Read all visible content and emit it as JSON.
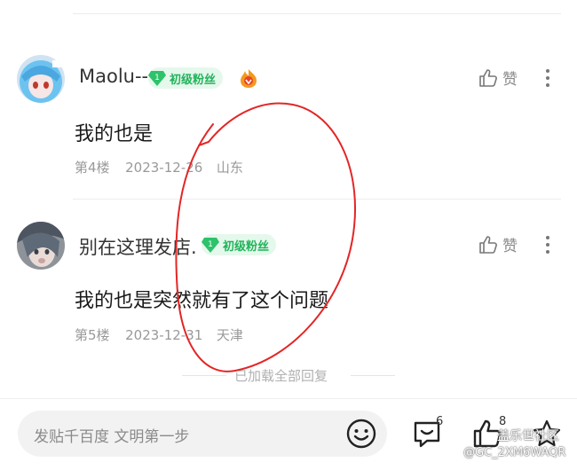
{
  "comments": [
    {
      "username": "Maolu--",
      "level": "1",
      "fan_badge": "初级粉丝",
      "like_label": "赞",
      "content": "我的也是",
      "floor": "第4楼",
      "date": "2023-12-26",
      "location": "山东"
    },
    {
      "username": "别在这理发店.",
      "level": "1",
      "fan_badge": "初级粉丝",
      "like_label": "赞",
      "content": "我的也是突然就有了这个问题",
      "floor": "第5楼",
      "date": "2023-12-31",
      "location": "天津"
    }
  ],
  "loaded_all_text": "已加载全部回复",
  "bottom_bar": {
    "placeholder": "发贴千百度 文明第一步",
    "reply_count": "6",
    "like_count": "8"
  },
  "watermark": {
    "line1": "盖乐世社区",
    "line2": "@GC_2XM6WAQR"
  },
  "colors": {
    "badge_green": "#22b25a",
    "annotation_red": "#e32626"
  },
  "icons": [
    "vip-fire-icon",
    "thumb-up-icon",
    "more-icon",
    "emoji-icon",
    "reply-icon",
    "like-icon",
    "share-icon",
    "level-gem-icon"
  ]
}
